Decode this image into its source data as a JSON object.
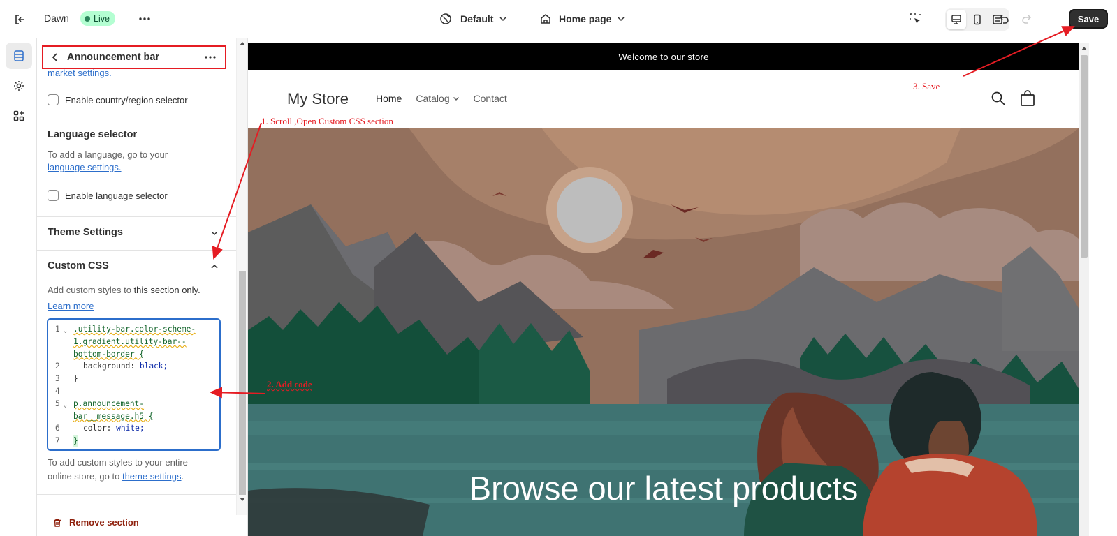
{
  "topbar": {
    "theme_name": "Dawn",
    "status": "Live",
    "theme_select": "Default",
    "page_select": "Home page",
    "save_label": "Save"
  },
  "panel": {
    "title": "Announcement bar",
    "market_link_fragment": "market settings.",
    "country_selector_label": "Enable country/region selector",
    "language_heading": "Language selector",
    "language_text": "To add a language, go to your",
    "language_link": "language settings.",
    "language_selector_label": "Enable language selector",
    "theme_settings_heading": "Theme Settings",
    "custom_css_heading": "Custom CSS",
    "custom_css_desc_pre": "Add custom styles to ",
    "custom_css_desc_bold": "this section only.",
    "learn_more": "Learn more",
    "code_lines": [
      {
        "num": "1",
        "fold": true,
        "parts": [
          ".utility-bar.color-scheme-",
          "1.gradient.utility-bar--",
          "bottom-border {"
        ]
      },
      {
        "num": "2",
        "text_prop": "background:",
        "text_val": "black;"
      },
      {
        "num": "3",
        "text": "}"
      },
      {
        "num": "4",
        "text": ""
      },
      {
        "num": "5",
        "fold": true,
        "parts": [
          "p.announcement-",
          "bar__message.h5 {"
        ]
      },
      {
        "num": "6",
        "text_prop": "color:",
        "text_val": "white;"
      },
      {
        "num": "7",
        "text": "}"
      }
    ],
    "footer_text_1": "To add custom styles to your entire",
    "footer_text_2_pre": "online store, go to ",
    "footer_link": "theme settings",
    "footer_text_2_post": ".",
    "remove_section": "Remove section"
  },
  "preview": {
    "announcement": "Welcome to our store",
    "store_name": "My Store",
    "nav": [
      "Home",
      "Catalog",
      "Contact"
    ],
    "hero_heading": "Browse our latest products"
  },
  "annotations": {
    "step1": "1. Scroll ,Open Custom CSS section",
    "step2": "2. Add code",
    "step3": "3. Save"
  },
  "colors": {
    "annotation_red": "#e51c23",
    "link_blue": "#2c6ecb",
    "live_green": "#b4fed2"
  }
}
